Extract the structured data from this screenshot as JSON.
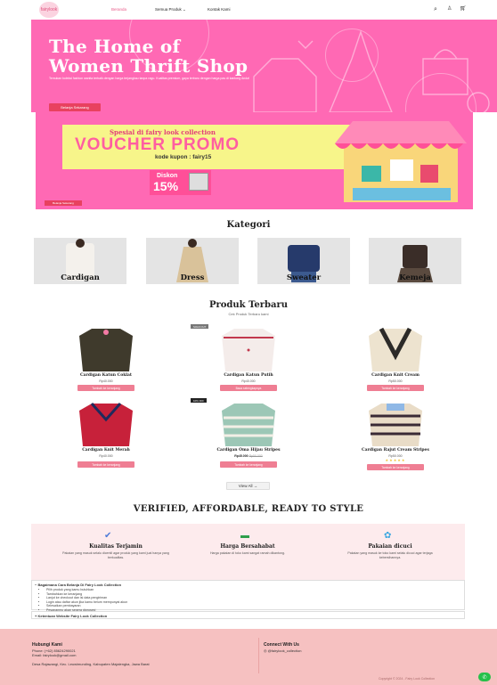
{
  "header": {
    "logo_text": "fairylook",
    "nav": [
      "Beranda",
      "Semua Produk",
      "Kontak Kami"
    ],
    "icons": [
      "search-icon",
      "user-icon",
      "cart-icon"
    ]
  },
  "hero": {
    "title_line1": "The Home of",
    "title_line2": "Women Thrift Shop",
    "subtitle": "Temukan koleksi fashion wanita terbaik dengan harga terjangkau tanpa ragu. Kualitas premium, gaya terbaru dengan harga pas di kantong Anda!",
    "button": "Belanja Sekarang"
  },
  "promo": {
    "line1": "Spesial di fairy look collection",
    "title": "VOUCHER PROMO",
    "code": "kode kupon : fairy15",
    "discount_label": "Diskon",
    "discount_value": "15%",
    "button": "Belanja Sekarang"
  },
  "categories": {
    "title": "Kategori",
    "items": [
      "Cardigan",
      "Dress",
      "Sweater",
      "Kemeja"
    ]
  },
  "products": {
    "title": "Produk Terbaru",
    "subtitle": "Cek Produk Terbaru kami",
    "items": [
      {
        "name": "Cardigan Katun Coklat",
        "price": "Rp40.000",
        "button": "Tambah ke keranjang",
        "badge": ""
      },
      {
        "name": "Cardigan Katun Putih",
        "price": "Rp40.000",
        "button": "Baca selengkapnya",
        "badge": "SOLD OUT"
      },
      {
        "name": "Cardigan Knit Cream",
        "price": "Rp50.000",
        "button": "Tambah ke keranjang",
        "badge": ""
      },
      {
        "name": "Cardigan Knit Merah",
        "price": "Rp40.000",
        "button": "Tambah ke keranjang",
        "badge": ""
      },
      {
        "name": "Cardigan Oma Hijau Stripes",
        "price": "Rp45.000",
        "old_price": "Rp50.000",
        "button": "Tambah ke keranjang",
        "badge": "10% OFF"
      },
      {
        "name": "Cardigan Rajut Cream Stripes",
        "price": "Rp50.000",
        "button": "Tambah ke keranjang",
        "badge": "",
        "stars": "★★★★★"
      }
    ],
    "view_all": "View All"
  },
  "tagline": "VERIFIED, AFFORDABLE, READY TO STYLE",
  "features": [
    {
      "icon": "check-icon",
      "title": "Kualitas Terjamin",
      "desc": "Pakaian yang masuk selalu dicentil agar produk yang kami jual hanya yang berkualitas."
    },
    {
      "icon": "money-icon",
      "title": "Harga Bersahabat",
      "desc": "Harga pakaian di toko kami sangat ramah dikantong."
    },
    {
      "icon": "washing-icon",
      "title": "Pakaian dicuci",
      "desc": "Pakaian yang masuk ke toko kami selalu dicuci agar terjaga kebersihannya."
    }
  ],
  "accordion": {
    "item1_title": "Bagaimana Cara Belanja Di Fairy Look Collection",
    "steps": [
      "Pilih produk yang kamu butuhkan",
      "Tambahkan ke keranjang",
      "Lanjut ke checkout dan isi data pengiriman",
      "Login atau daftar akun jika kamu belum mempunyai akun",
      "Selesaikan pembayaran",
      "Pesananmu akan segera diproses!"
    ],
    "item2_title": "Ketentuan Website Fairy Look Collection"
  },
  "footer": {
    "contact_title": "Hubungi Kami",
    "phone": "Phone: (+62) 85624290021",
    "email": "Email: fairylook@gmail.com",
    "address": "Desa Rajawangi, Kec. Leuwimunding, Kabupaten Majalengka, Jawa Barat",
    "connect_title": "Connect With Us",
    "instagram": "@fairylook_collection",
    "copyright": "Copyright © 2024 - Fairy Look Collection"
  }
}
